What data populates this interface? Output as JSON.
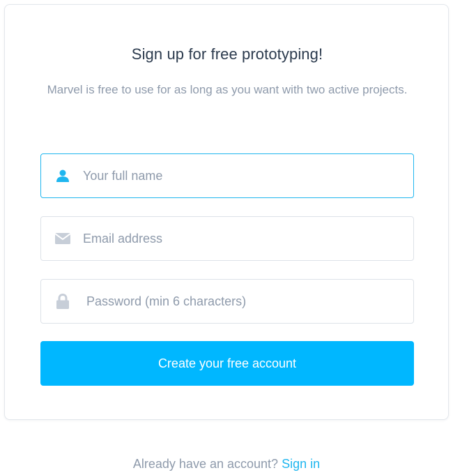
{
  "signup": {
    "title": "Sign up for free prototyping!",
    "subtitle": "Marvel is free to use for as long as you want with two active projects.",
    "fields": {
      "full_name": {
        "placeholder": "Your full name",
        "value": "",
        "icon": "user-icon",
        "icon_color": "#1fb6ef"
      },
      "email": {
        "placeholder": "Email address",
        "value": "",
        "icon": "envelope-icon",
        "icon_color": "#c7ced8"
      },
      "password": {
        "placeholder": "Password (min 6 characters)",
        "value": "",
        "icon": "lock-icon",
        "icon_color": "#c7ced8"
      }
    },
    "submit_label": "Create your free account"
  },
  "footer": {
    "prompt": "Already have an account?",
    "link_label": "Sign in"
  },
  "colors": {
    "accent": "#00b7ff",
    "focus_border": "#1fb6ef",
    "title": "#2b3a4d",
    "muted": "#8e9aab"
  }
}
